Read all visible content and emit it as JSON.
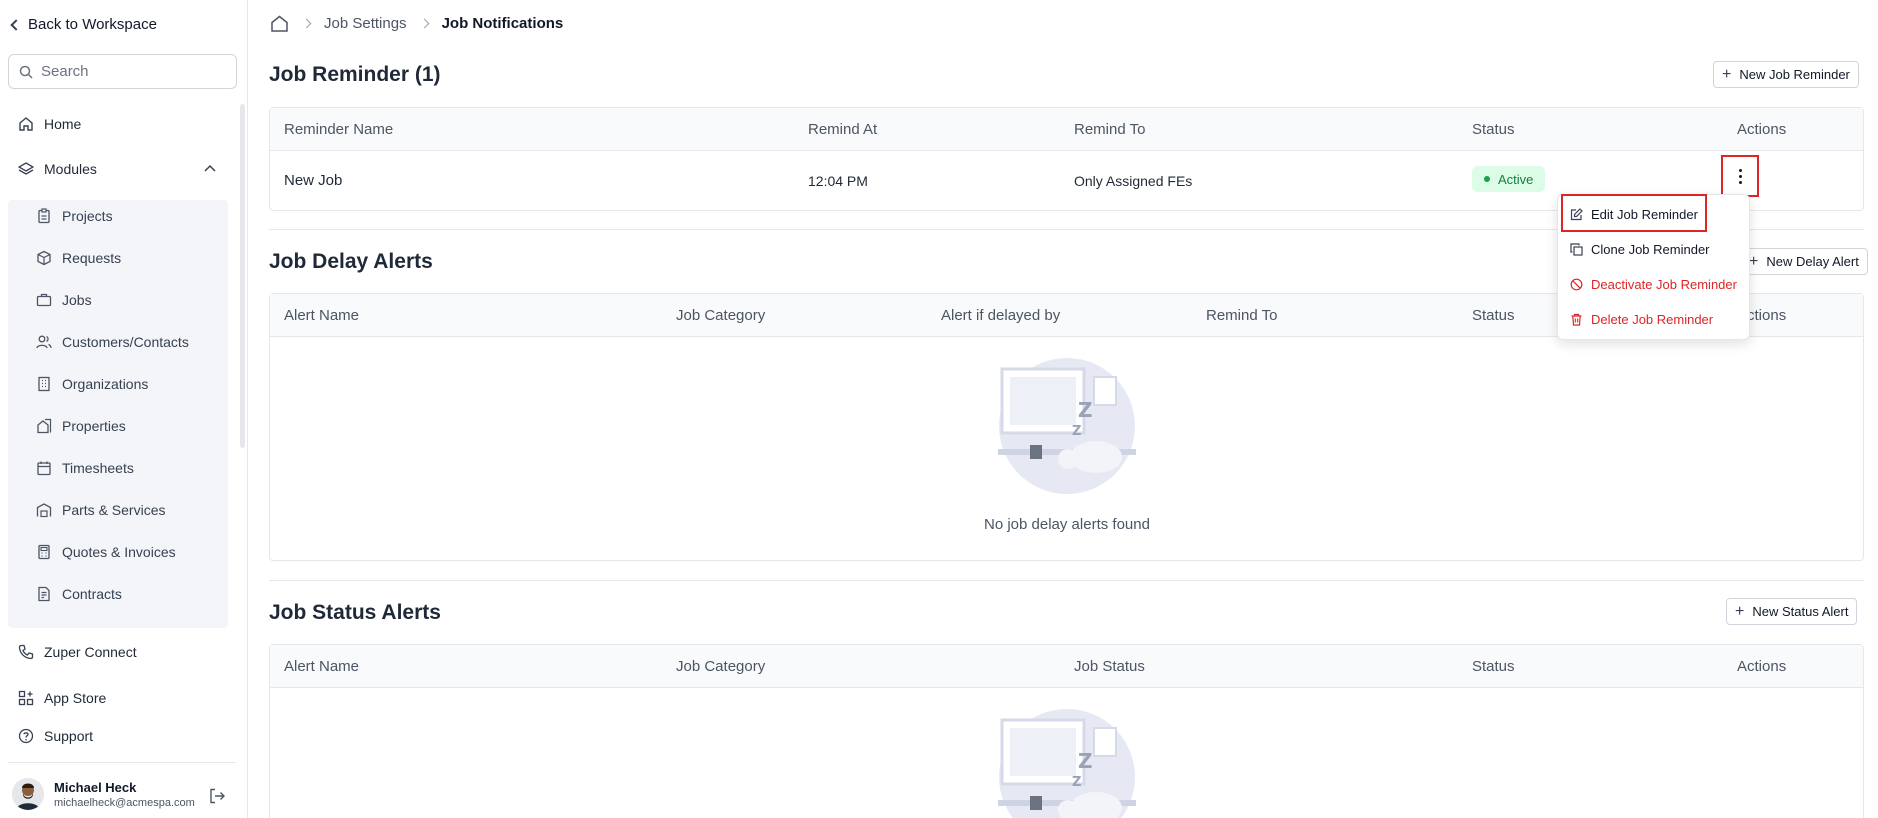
{
  "sidebar": {
    "back_label": "Back to Workspace",
    "search_placeholder": "Search",
    "home": "Home",
    "modules": "Modules",
    "module_items": [
      "Projects",
      "Requests",
      "Jobs",
      "Customers/Contacts",
      "Organizations",
      "Properties",
      "Timesheets",
      "Parts & Services",
      "Quotes & Invoices",
      "Contracts"
    ],
    "connect": "Zuper Connect",
    "app_store": "App Store",
    "support": "Support",
    "user": {
      "name": "Michael Heck",
      "email": "michaelheck@acmespa.com"
    }
  },
  "breadcrumb": {
    "settings": "Job Settings",
    "current": "Job Notifications"
  },
  "reminders": {
    "title": "Job Reminder (1)",
    "new_button": "New Job Reminder",
    "columns": [
      "Reminder Name",
      "Remind At",
      "Remind To",
      "Status",
      "Actions"
    ],
    "rows": [
      {
        "name": "New Job",
        "remind_at": "12:04 PM",
        "remind_to": "Only Assigned FEs",
        "status": "Active"
      }
    ]
  },
  "delay_alerts": {
    "title": "Job Delay Alerts",
    "new_button": "New Delay Alert",
    "columns": [
      "Alert Name",
      "Job Category",
      "Alert if delayed by",
      "Remind To",
      "Status",
      "Actions"
    ],
    "empty_text": "No job delay alerts found"
  },
  "status_alerts": {
    "title": "Job Status Alerts",
    "new_button": "New Status Alert",
    "columns": [
      "Alert Name",
      "Job Category",
      "Job Status",
      "Status",
      "Actions"
    ]
  },
  "dropdown": {
    "edit": "Edit Job Reminder",
    "clone": "Clone Job Reminder",
    "deactivate": "Deactivate Job Reminder",
    "delete": "Delete Job Reminder"
  },
  "colors": {
    "danger": "#dc2626",
    "active_bg": "#dcfce7",
    "active_text": "#15803d"
  }
}
